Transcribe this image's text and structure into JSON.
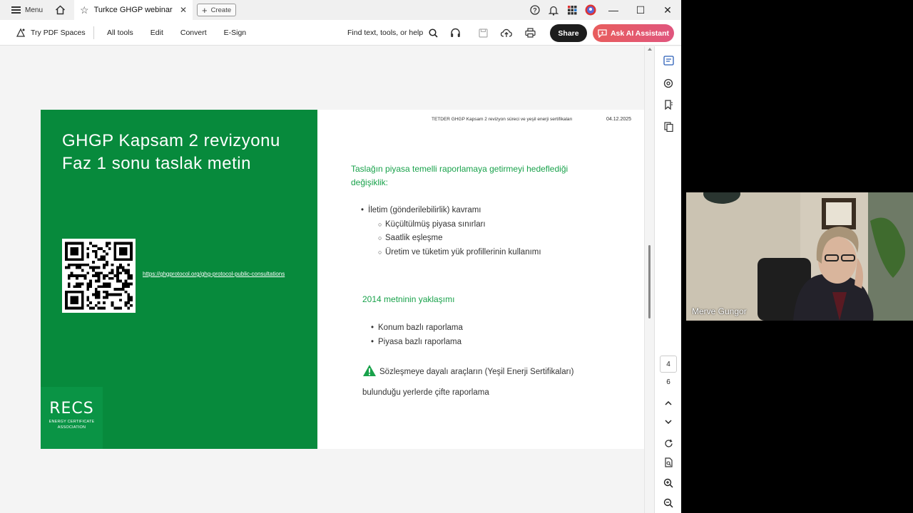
{
  "titlebar": {
    "menu_label": "Menu",
    "tab_title": "Turkce GHGP webinar",
    "create_label": "Create",
    "minimize": "—",
    "maximize": "☐",
    "close": "✕"
  },
  "toolbar": {
    "spaces_label": "Try PDF Spaces",
    "nav": [
      "All tools",
      "Edit",
      "Convert",
      "E-Sign"
    ],
    "find_label": "Find text, tools, or help",
    "share_label": "Share",
    "ai_label": "Ask AI Assistant"
  },
  "slide": {
    "title_line1": "GHGP Kapsam 2 revizyonu",
    "title_line2": "Faz 1 sonu taslak metin",
    "qr_link": "https://ghgprotocol.org/ghg-protocol-public-consultations",
    "recs_logo": "RECS",
    "recs_sub1": "ENERGY CERTIFICATE",
    "recs_sub2": "ASSOCIATION",
    "header": "TETDER GHGP Kapsam 2 revizyon süreci ve yeşil enerji sertifikaları",
    "date": "04.12.2025",
    "green_heading": "Taslağın piyasa temelli raporlamaya getirmeyi hedeflediği değişiklik:",
    "bullet_main": "İletim (gönderilebilirlik) kavramı",
    "sub_bullets": [
      "Küçültülmüş piyasa sınırları",
      "Saatlik eşleşme",
      "Üretim ve tüketim yük profillerinin kullanımı"
    ],
    "heading2": "2014 metninin yaklaşımı",
    "list2": [
      "Konum bazlı raporlama",
      "Piyasa bazlı raporlama"
    ],
    "warning_text": "Sözleşmeye dayalı araçların (Yeşil Enerji Sertifikaları) bulunduğu yerlerde çifte raporlama"
  },
  "pager": {
    "current": "4",
    "total": "6"
  },
  "video": {
    "participant_name": "Merve Gungor"
  },
  "colors": {
    "slide_green": "#078a3c",
    "heading_green": "#19a24b",
    "ai_button": "#e85d5d",
    "share_button": "#1d1d1d"
  }
}
